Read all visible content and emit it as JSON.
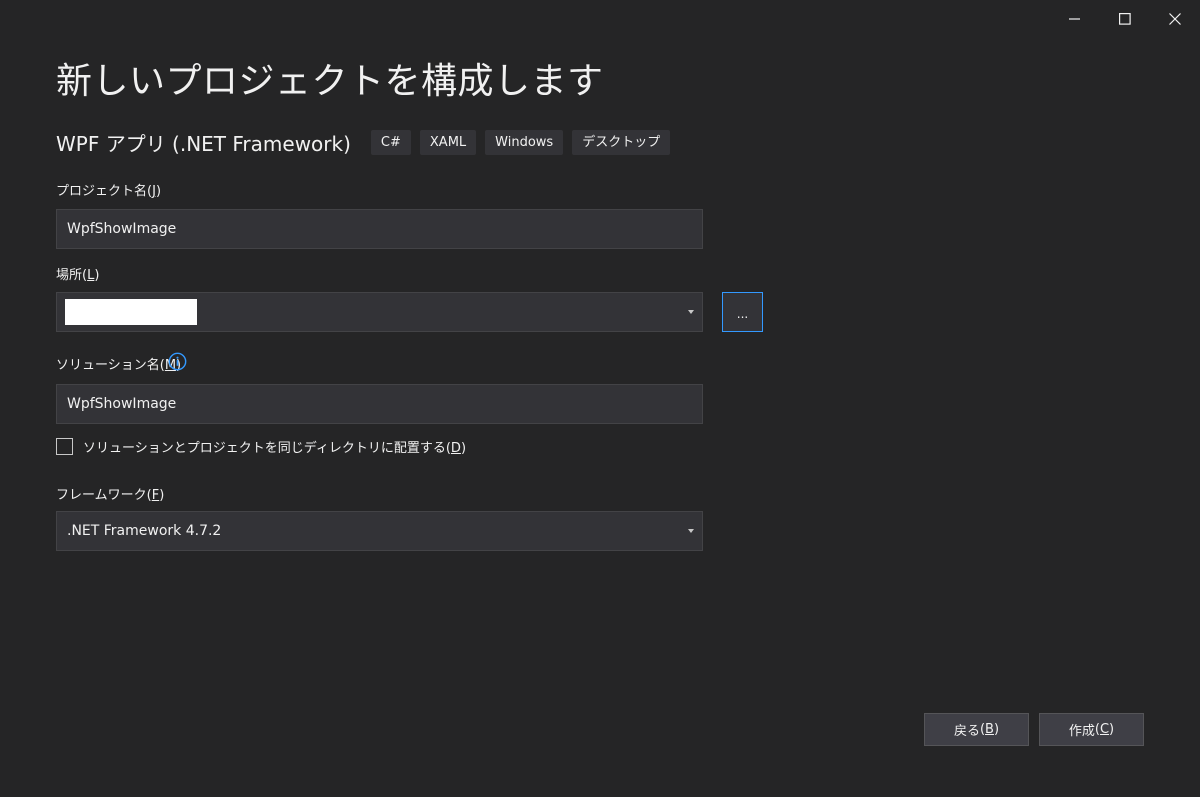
{
  "window": {
    "minimize_icon": "minimize-icon",
    "maximize_icon": "maximize-icon",
    "close_icon": "close-icon"
  },
  "header": {
    "title": "新しいプロジェクトを構成します",
    "template_name": "WPF アプリ (.NET Framework)",
    "tags": [
      "C#",
      "XAML",
      "Windows",
      "デスクトップ"
    ]
  },
  "fields": {
    "project_name": {
      "label": "プロジェクト名",
      "accesskey": "J",
      "value": "WpfShowImage"
    },
    "location": {
      "label": "場所",
      "accesskey": "L",
      "value": "",
      "browse_label": "..."
    },
    "solution_name": {
      "label": "ソリューション名",
      "accesskey": "M",
      "value": "WpfShowImage",
      "info_icon": "info-icon"
    },
    "same_dir_checkbox": {
      "label": "ソリューションとプロジェクトを同じディレクトリに配置する",
      "accesskey": "D",
      "checked": false
    },
    "framework": {
      "label": "フレームワーク",
      "accesskey": "F",
      "value": ".NET Framework 4.7.2"
    }
  },
  "buttons": {
    "back": {
      "label": "戻る",
      "accesskey": "B"
    },
    "create": {
      "label": "作成",
      "accesskey": "C"
    }
  },
  "colors": {
    "background": "#252526",
    "input_background": "#333337",
    "focus_border": "#3399ff",
    "info_icon": "#3399ff"
  }
}
